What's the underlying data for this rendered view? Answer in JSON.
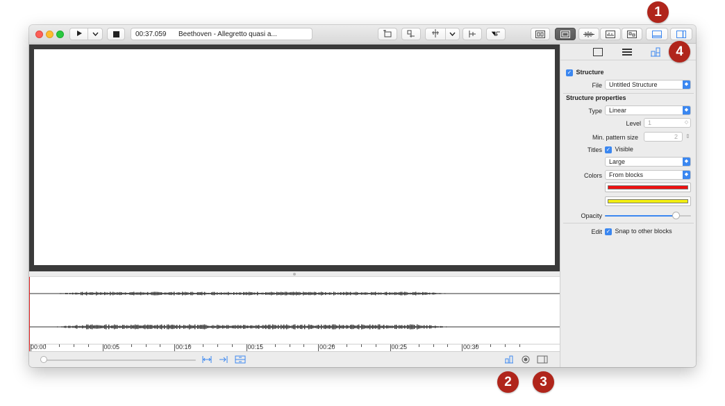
{
  "toolbar": {
    "time": "00:37.059",
    "track_title": "Beethoven - Allegretto quasi a..."
  },
  "inspector": {
    "structure_label": "Structure",
    "file_label": "File",
    "file_value": "Untitled Structure",
    "properties_heading": "Structure properties",
    "type_label": "Type",
    "type_value": "Linear",
    "level_label": "Level",
    "level_value": "1",
    "min_pattern_label": "Min. pattern size",
    "min_pattern_value": "2",
    "titles_label": "Titles",
    "titles_visible_label": "Visible",
    "titles_size_value": "Large",
    "colors_label": "Colors",
    "colors_value": "From blocks",
    "color_swatches": [
      "#ee1111",
      "#f2ee11"
    ],
    "opacity_label": "Opacity",
    "opacity_level": 0.82,
    "edit_label": "Edit",
    "snap_label": "Snap to other blocks"
  },
  "ruler": {
    "labels": [
      "00:00",
      "00:05",
      "00:10",
      "00:15",
      "00:20",
      "00:25",
      "00:30"
    ]
  },
  "badges": [
    "1",
    "2",
    "3",
    "4"
  ],
  "colors": {
    "accent": "#3b87f0",
    "badge": "#b0251b",
    "playhead": "#e02020"
  }
}
